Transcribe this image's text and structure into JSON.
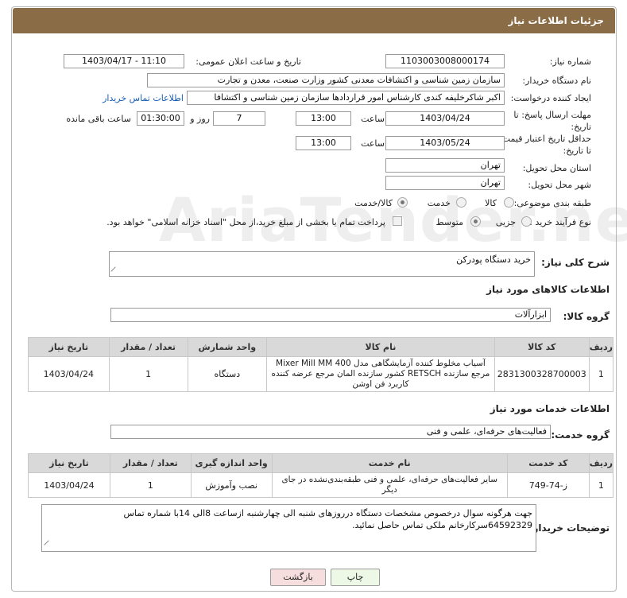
{
  "header": {
    "title": "جزئیات اطلاعات نیاز"
  },
  "fields": {
    "need_number": {
      "label": "شماره نیاز:",
      "value": "1103003008000174"
    },
    "announce_datetime": {
      "label": "تاریخ و ساعت اعلان عمومی:",
      "value": "1403/04/17 - 11:10"
    },
    "buyer_org": {
      "label": "نام دستگاه خریدار:",
      "value": "سازمان زمین شناسی و اکتشافات معدنی کشور وزارت صنعت، معدن و تجارت"
    },
    "requester": {
      "label": "ایجاد کننده درخواست:",
      "value": "اکبر شاکرخلیفه کندی کارشناس امور قراردادها سازمان زمین شناسی و اکتشافا",
      "contact_link": "اطلاعات تماس خریدار"
    },
    "reply_deadline": {
      "label": "مهلت ارسال پاسخ: تا تاریخ:",
      "date": "1403/04/24",
      "time_label": "ساعت",
      "time": "13:00",
      "days": "7",
      "days_label": "روز و",
      "remaining": "01:30:00",
      "remaining_label": "ساعت باقی مانده"
    },
    "price_validity": {
      "label": "حداقل تاریخ اعتبار قیمت: تا تاریخ:",
      "date": "1403/05/24",
      "time_label": "ساعت",
      "time": "13:00"
    },
    "province": {
      "label": "استان محل تحویل:",
      "value": "تهران"
    },
    "city": {
      "label": "شهر محل تحویل:",
      "value": "تهران"
    },
    "category": {
      "label": "طبقه بندی موضوعی:",
      "options": [
        "کالا",
        "خدمت",
        "کالا/خدمت"
      ],
      "selected": "کالا/خدمت"
    },
    "purchase_process": {
      "label": "نوع فرآیند خرید :",
      "options": [
        "جزیی",
        "متوسط"
      ],
      "selected": "متوسط",
      "payment_note": "پرداخت تمام یا بخشی از مبلغ خرید،از محل \"اسناد خزانه اسلامی\" خواهد بود."
    }
  },
  "summary": {
    "label": "شرح کلی نیاز:",
    "value": "خرید دستگاه پودرکن"
  },
  "goods": {
    "section_title": "اطلاعات کالاهای مورد نیاز",
    "group_label": "گروه کالا:",
    "group_value": "ابزارآلات",
    "columns": [
      "ردیف",
      "کد کالا",
      "نام کالا",
      "واحد شمارش",
      "تعداد / مقدار",
      "تاریخ نیاز"
    ],
    "rows": [
      {
        "index": "1",
        "code": "2831300328700003",
        "name": "آسیاب مخلوط کننده آزمایشگاهی مدل Mixer Mill MM 400 مرجع سازنده RETSCH کشور سازنده المان مرجع عرضه کننده کاربرد فن اوشن",
        "unit": "دستگاه",
        "qty": "1",
        "date": "1403/04/24"
      }
    ]
  },
  "services": {
    "section_title": "اطلاعات خدمات مورد نیاز",
    "group_label": "گروه خدمت:",
    "group_value": "فعالیت‌های حرفه‌ای، علمی و فنی",
    "columns": [
      "ردیف",
      "کد خدمت",
      "نام خدمت",
      "واحد اندازه گیری",
      "تعداد / مقدار",
      "تاریخ نیاز"
    ],
    "rows": [
      {
        "index": "1",
        "code": "ز-74-749",
        "name": "سایر فعالیت‌های حرفه‌ای، علمی و فنی طبقه‌بندی‌نشده در جای دیگر",
        "unit": "نصب وآموزش",
        "qty": "1",
        "date": "1403/04/24"
      }
    ]
  },
  "buyer_notes": {
    "label": "توضیحات خریدار:",
    "value": "جهت هرگونه سوال درخصوص مشخصات دستگاه درروزهای شنبه الی چهارشنبه ازساعت 8الی 14با شماره تماس 64592329سرکارخانم ملکی تماس حاصل نمائید."
  },
  "buttons": {
    "print": "چاپ",
    "back": "بازگشت"
  },
  "watermark": "AriaTender.neT",
  "colors": {
    "header": "#8a6d47",
    "back_button": "#f6dede",
    "print_button": "#eef8e6",
    "link": "#1a5fb4"
  }
}
